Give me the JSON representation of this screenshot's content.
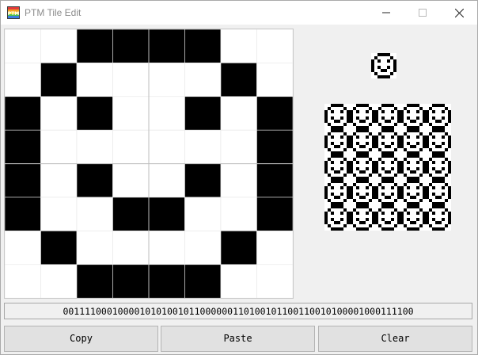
{
  "window": {
    "title": "PTM Tile Edit"
  },
  "tile": {
    "size": 8,
    "pixels": [
      [
        0,
        0,
        1,
        1,
        1,
        1,
        0,
        0
      ],
      [
        0,
        1,
        0,
        0,
        0,
        0,
        1,
        0
      ],
      [
        1,
        0,
        1,
        0,
        0,
        1,
        0,
        1
      ],
      [
        1,
        0,
        0,
        0,
        0,
        0,
        0,
        1
      ],
      [
        1,
        0,
        1,
        0,
        0,
        1,
        0,
        1
      ],
      [
        1,
        0,
        0,
        1,
        1,
        0,
        0,
        1
      ],
      [
        0,
        1,
        0,
        0,
        0,
        0,
        1,
        0
      ],
      [
        0,
        0,
        1,
        1,
        1,
        1,
        0,
        0
      ]
    ]
  },
  "preview": {
    "repeat_cols": 5,
    "repeat_rows": 5
  },
  "bit_string": "0011110001000010101001011000000110100101100110010100001000111100",
  "buttons": {
    "copy": "Copy",
    "paste": "Paste",
    "clear": "Clear"
  },
  "colors": {
    "on": "#000000",
    "off": "#ffffff",
    "gridline": "#e6e6e6"
  }
}
